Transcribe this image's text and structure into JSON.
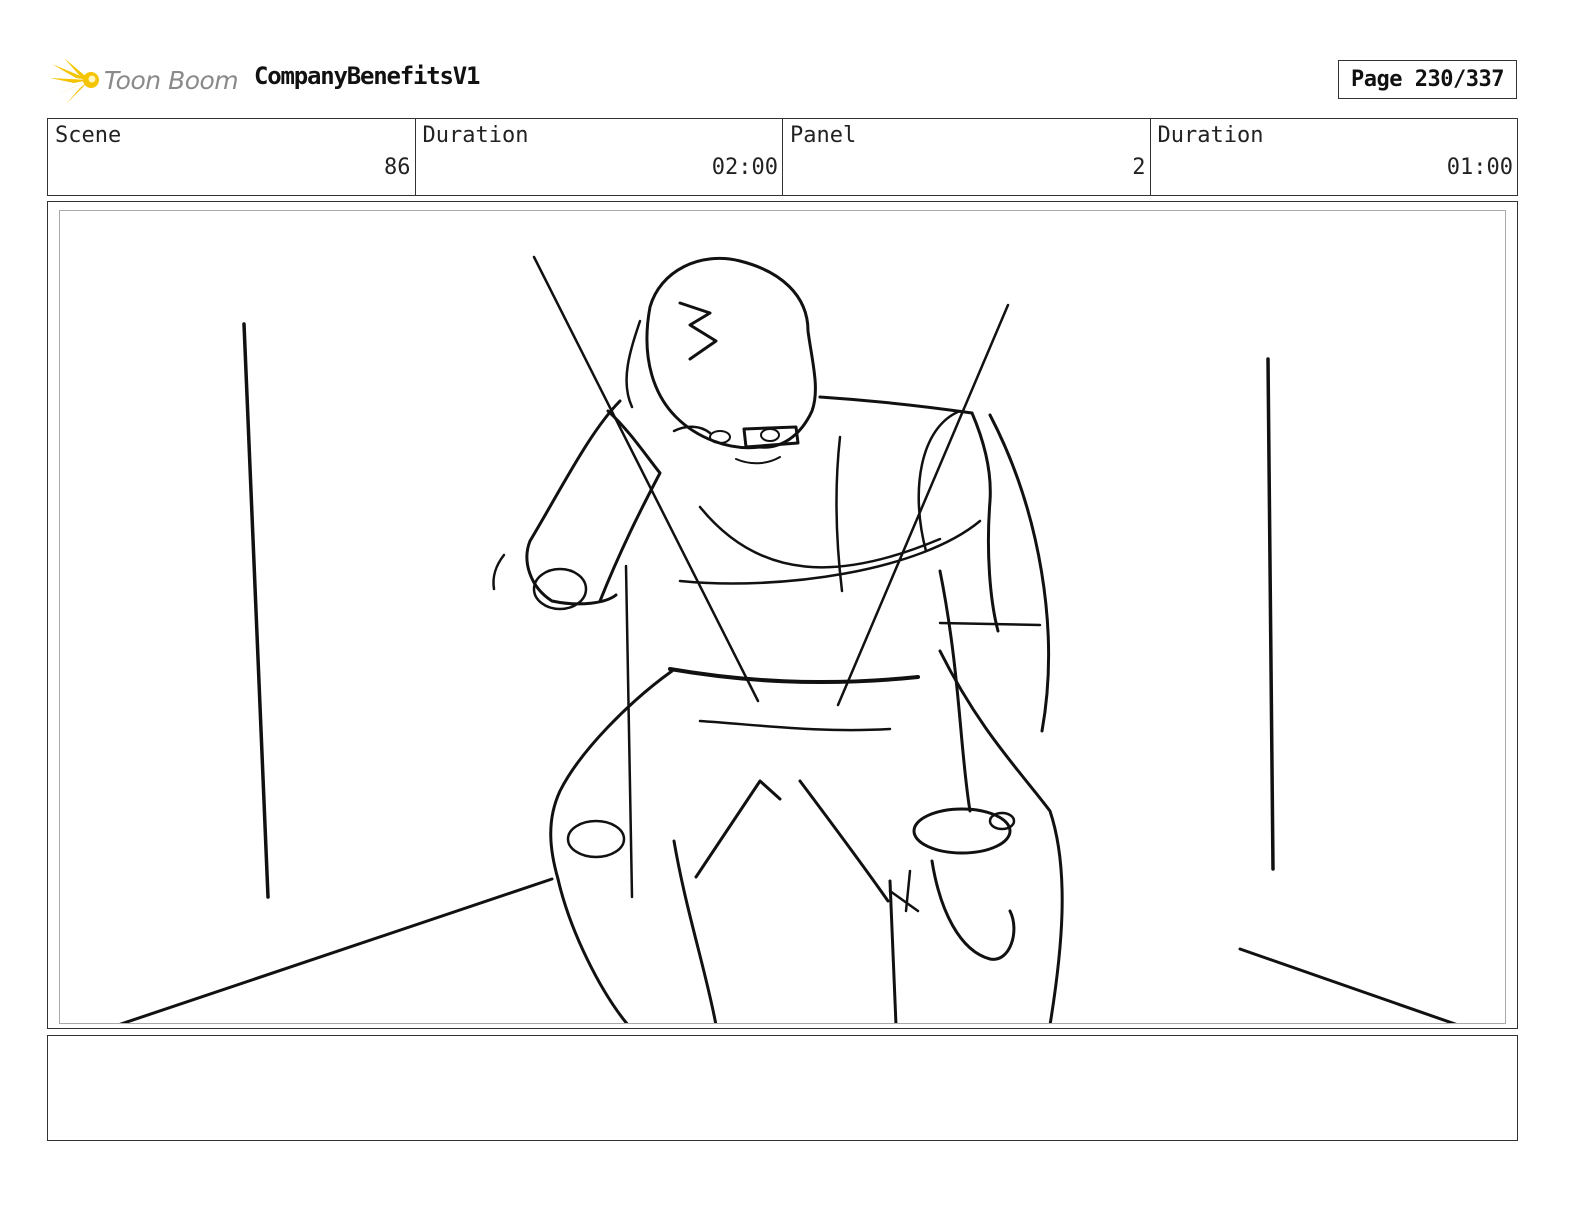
{
  "header": {
    "logo_text": "Toon Boom",
    "project_title": "CompanyBenefitsV1",
    "page_label": "Page 230/337"
  },
  "info": {
    "scene_label": "Scene",
    "scene_value": "86",
    "scene_duration_label": "Duration",
    "scene_duration_value": "02:00",
    "panel_label": "Panel",
    "panel_value": "2",
    "panel_duration_label": "Duration",
    "panel_duration_value": "01:00"
  },
  "caption": {
    "text": ""
  },
  "colors": {
    "logo_accent": "#f5c400",
    "logo_text": "#8a8a8a"
  },
  "icons": {
    "logo": "starburst-logo-icon"
  }
}
